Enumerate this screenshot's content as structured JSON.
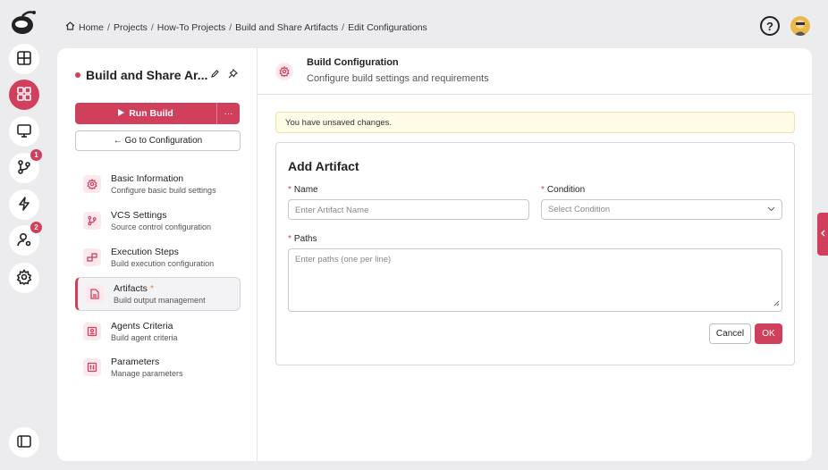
{
  "rail": {
    "items": [
      {
        "name": "dashboard",
        "icon": "layout-icon"
      },
      {
        "name": "projects",
        "icon": "grid-icon",
        "active": true
      },
      {
        "name": "monitor",
        "icon": "monitor-icon"
      },
      {
        "name": "version-control",
        "icon": "branch-icon",
        "badge": "1"
      },
      {
        "name": "activity",
        "icon": "bolt-icon"
      },
      {
        "name": "users",
        "icon": "user-gear-icon",
        "badge": "2"
      },
      {
        "name": "settings",
        "icon": "gear-icon"
      }
    ]
  },
  "breadcrumb": [
    "Home",
    "Projects",
    "How-To Projects",
    "Build and Share Artifacts",
    "Edit Configurations"
  ],
  "topbar": {
    "help": "?"
  },
  "project": {
    "title": "Build and Share Ar...",
    "run_label": "Run Build",
    "more_label": "···",
    "goto_label": "← Go to Configuration"
  },
  "nav": [
    {
      "label": "Basic Information",
      "sub": "Configure basic build settings",
      "icon": "gear-icon"
    },
    {
      "label": "VCS Settings",
      "sub": "Source control configuration",
      "icon": "branch-icon"
    },
    {
      "label": "Execution Steps",
      "sub": "Build execution configuration",
      "icon": "steps-icon"
    },
    {
      "label": "Artifacts",
      "sub": "Build output management",
      "icon": "file-icon",
      "active": true,
      "star": "*"
    },
    {
      "label": "Agents Criteria",
      "sub": "Build agent criteria",
      "icon": "agent-icon"
    },
    {
      "label": "Parameters",
      "sub": "Manage parameters",
      "icon": "sliders-icon"
    }
  ],
  "header": {
    "title": "Build Configuration",
    "subtitle": "Configure build settings and requirements"
  },
  "warning": "You have unsaved changes.",
  "form": {
    "title": "Add Artifact",
    "name_label": "Name",
    "name_placeholder": "Enter Artifact Name",
    "condition_label": "Condition",
    "condition_placeholder": "Select Condition",
    "paths_label": "Paths",
    "paths_placeholder": "Enter paths (one per line)",
    "required_mark": "*",
    "cancel_label": "Cancel",
    "ok_label": "OK"
  },
  "colors": {
    "accent": "#d0405d",
    "warning_bg": "#fefbe6"
  }
}
